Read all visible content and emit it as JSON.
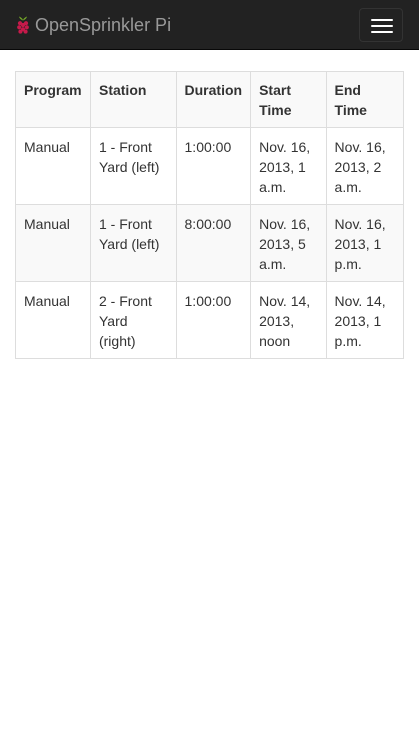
{
  "navbar": {
    "brand": "OpenSprinkler Pi",
    "logo_icon": "raspberry-pi-logo-icon",
    "toggle_icon": "hamburger-menu-icon",
    "background": "#222222",
    "brand_color": "#999999"
  },
  "table": {
    "headers": [
      "Program",
      "Station",
      "Duration",
      "Start Time",
      "End Time"
    ],
    "rows": [
      {
        "program": "Manual",
        "station": "1 - Front Yard (left)",
        "duration": "1:00:00",
        "start": "Nov. 16, 2013, 1 a.m.",
        "end": "Nov. 16, 2013, 2 a.m."
      },
      {
        "program": "Manual",
        "station": "1 - Front Yard (left)",
        "duration": "8:00:00",
        "start": "Nov. 16, 2013, 5 a.m.",
        "end": "Nov. 16, 2013, 1 p.m."
      },
      {
        "program": "Manual",
        "station": "2 - Front Yard (right)",
        "duration": "1:00:00",
        "start": "Nov. 14, 2013, noon",
        "end": "Nov. 14, 2013, 1 p.m."
      }
    ]
  }
}
